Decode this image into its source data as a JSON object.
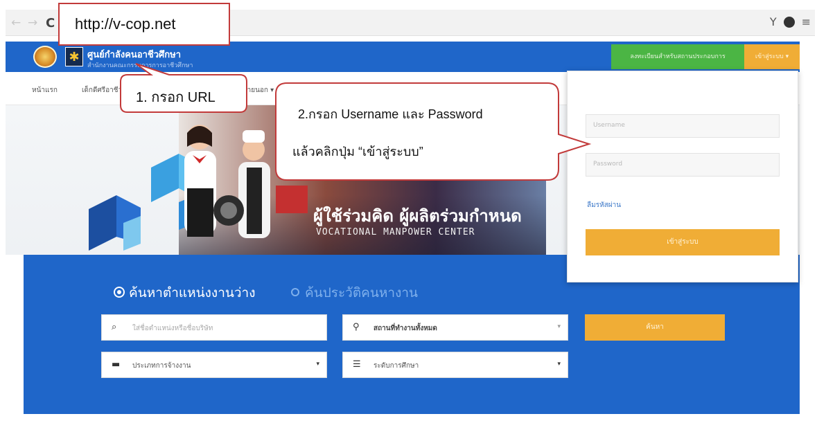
{
  "browser": {
    "url": "http://v-cop.net",
    "back_icon": "arrow-left",
    "forward_icon": "arrow-right",
    "reload_icon": "reload"
  },
  "site": {
    "title": "ศูนย์กำลังคนอาชีวศึกษา",
    "subtitle": "สำนักงานคณะกรรมการการอาชีวศึกษา",
    "register_label": "ลงทะเบียนสำหรับสถานประกอบการ",
    "login_label": "เข้าสู่ระบบ ▾",
    "colors": {
      "brand_blue": "#1f66c9",
      "green": "#4bb544",
      "orange": "#f0ad36",
      "callout_red": "#c23a3a"
    }
  },
  "nav": {
    "items": [
      "หน้าแรก",
      "เด็กดีศรีอาชีวะ",
      "ภายนอก ▾"
    ]
  },
  "hero": {
    "tagline_th": "ผู้ใช้ร่วมคิด ผู้ผลิตร่วมกำหนด",
    "tagline_en": "VOCATIONAL MANPOWER CENTER"
  },
  "search": {
    "mode_active": "ค้นหาตำแหน่งงานว่าง",
    "mode_inactive": "ค้นประวัติคนหางาน",
    "keyword_placeholder": "ใส่ชื่อตำแหน่งหรือชื่อบริษัท",
    "location_value": "สถานที่ทำงานทั้งหมด",
    "employment_type_value": "ประเภทการจ้างงาน",
    "education_value": "ระดับการศึกษา",
    "search_button": "ค้นหา"
  },
  "login_panel": {
    "username_placeholder": "Username",
    "password_placeholder": "Password",
    "forgot_password": "ลืมรหัสผ่าน",
    "submit_label": "เข้าสู่ระบบ"
  },
  "callouts": {
    "step1": "1. กรอก URL",
    "step2_line1": "2.กรอก Username และ Password",
    "step2_line2": "แล้วคลิกปุ่ม “เข้าสู่ระบบ”"
  }
}
